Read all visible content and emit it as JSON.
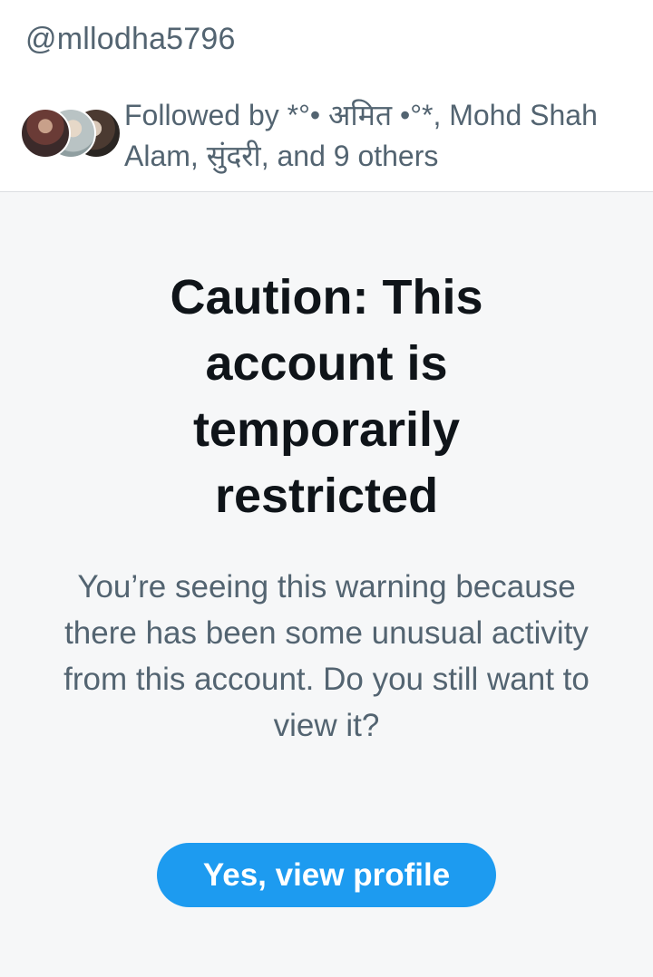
{
  "header": {
    "handle": "@mllodha5796",
    "followed_by": "Followed by *°• अमित •°*, Mohd Shah Alam, सुंदरी, and 9 others"
  },
  "warning": {
    "title": "Caution: This account is temporarily restricted",
    "message": "You’re seeing this warning because there has been some unusual activity from this account. Do you still want to view it?",
    "button_label": "Yes, view profile"
  },
  "colors": {
    "accent": "#1d9bf0",
    "panel_bg": "#f6f7f8",
    "text_primary": "#0f1419",
    "text_secondary": "#536471"
  }
}
